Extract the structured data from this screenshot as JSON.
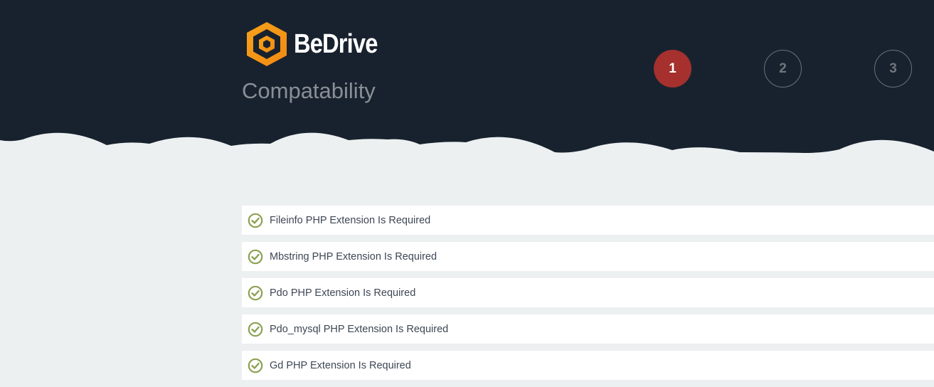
{
  "brand": {
    "name": "BeDrive",
    "accent_color": "#f79a1e"
  },
  "page": {
    "title": "Compatability"
  },
  "steps": [
    {
      "label": "1",
      "state": "active",
      "color": "#a5302d"
    },
    {
      "label": "2",
      "state": "inactive"
    },
    {
      "label": "3",
      "state": "inactive"
    }
  ],
  "requirements": [
    {
      "label": "Fileinfo PHP Extension Is Required",
      "status": "passed",
      "icon": "check-circle-icon"
    },
    {
      "label": "Mbstring PHP Extension Is Required",
      "status": "passed",
      "icon": "check-circle-icon"
    },
    {
      "label": "Pdo PHP Extension Is Required",
      "status": "passed",
      "icon": "check-circle-icon"
    },
    {
      "label": "Pdo_mysql PHP Extension Is Required",
      "status": "passed",
      "icon": "check-circle-icon"
    },
    {
      "label": "Gd PHP Extension Is Required",
      "status": "passed",
      "icon": "check-circle-icon"
    }
  ],
  "colors": {
    "header_bg": "#18222f",
    "page_bg": "#ecf0f1",
    "check_green": "#8aa152"
  }
}
